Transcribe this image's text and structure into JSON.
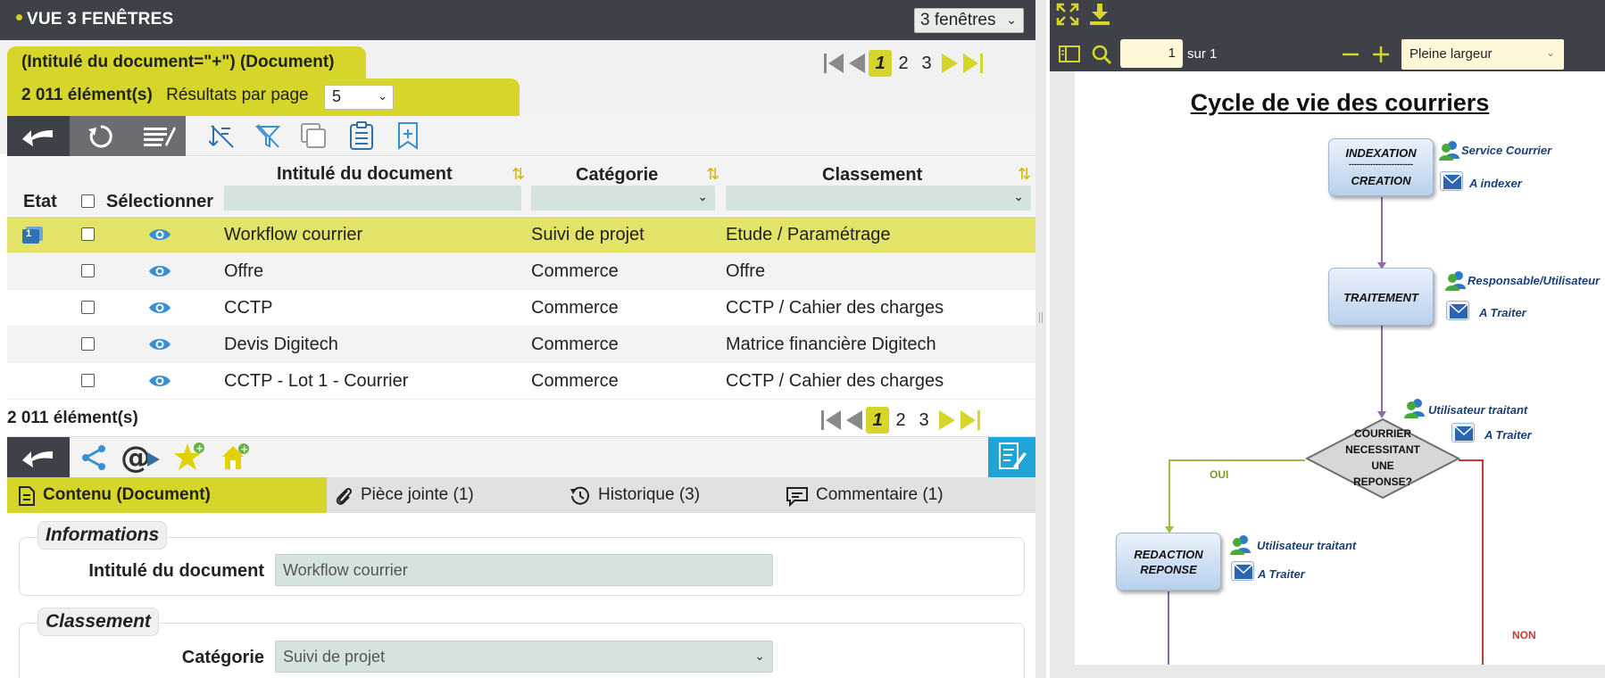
{
  "window": {
    "title": "VUE 3 FENÊTRES",
    "view_select": "3 fenêtres"
  },
  "list": {
    "tab_title": "(Intitulé du document=\"+\") (Document)",
    "count": "2 011 élément(s)",
    "per_page_label": "Résultats par page",
    "per_page_value": "5",
    "pages": [
      "1",
      "2",
      "3"
    ],
    "columns": {
      "etat": "Etat",
      "select": "Sélectionner",
      "title": "Intitulé du document",
      "category": "Catégorie",
      "classement": "Classement"
    },
    "rows": [
      {
        "title": "Workflow courrier",
        "category": "Suivi de projet",
        "classement": "Etude / Paramétrage",
        "badge": "1"
      },
      {
        "title": "Offre",
        "category": "Commerce",
        "classement": "Offre"
      },
      {
        "title": "CCTP",
        "category": "Commerce",
        "classement": "CCTP / Cahier des charges"
      },
      {
        "title": "Devis Digitech",
        "category": "Commerce",
        "classement": "Matrice financière Digitech"
      },
      {
        "title": "CCTP - Lot 1 - Courrier",
        "category": "Commerce",
        "classement": "CCTP / Cahier des charges"
      }
    ],
    "bottom_count": "2 011 élément(s)"
  },
  "detail": {
    "tabs": [
      {
        "label": "Contenu (Document)",
        "icon": "document-icon"
      },
      {
        "label": "Pièce jointe (1)",
        "icon": "paperclip-icon"
      },
      {
        "label": "Historique (3)",
        "icon": "history-icon"
      },
      {
        "label": "Commentaire (1)",
        "icon": "comment-icon"
      }
    ],
    "informations": {
      "legend": "Informations",
      "field_label": "Intitulé du document",
      "field_value": "Workflow courrier"
    },
    "classement": {
      "legend": "Classement",
      "field_label": "Catégorie",
      "field_value": "Suivi de projet"
    }
  },
  "viewer": {
    "page_value": "1",
    "page_total": "sur 1",
    "zoom": "Pleine largeur",
    "doc": {
      "title": "Cycle de vie des courriers",
      "step1_top": "INDEXATION",
      "step1_sep": "------------------------",
      "step1_bottom": "CREATION",
      "step1_role": "Service Courrier",
      "step1_status": "A indexer",
      "step2": "TRAITEMENT",
      "step2_role": "Responsable/Utilisateur",
      "step2_status": "A Traiter",
      "decision_l1": "COURRIER",
      "decision_l2": "NECESSITANT",
      "decision_l3": "UNE",
      "decision_l4": "REPONSE?",
      "decision_role": "Utilisateur traitant",
      "decision_status": "A Traiter",
      "yes": "OUI",
      "no": "NON",
      "step3_l1": "REDACTION",
      "step3_l2": "REPONSE",
      "step3_role": "Utilisateur traitant",
      "step3_status": "A Traiter"
    }
  },
  "colors": {
    "accent": "#d5d52a",
    "dark": "#3e4148",
    "field": "#d4e4dc",
    "eye": "#3a8fd0"
  }
}
